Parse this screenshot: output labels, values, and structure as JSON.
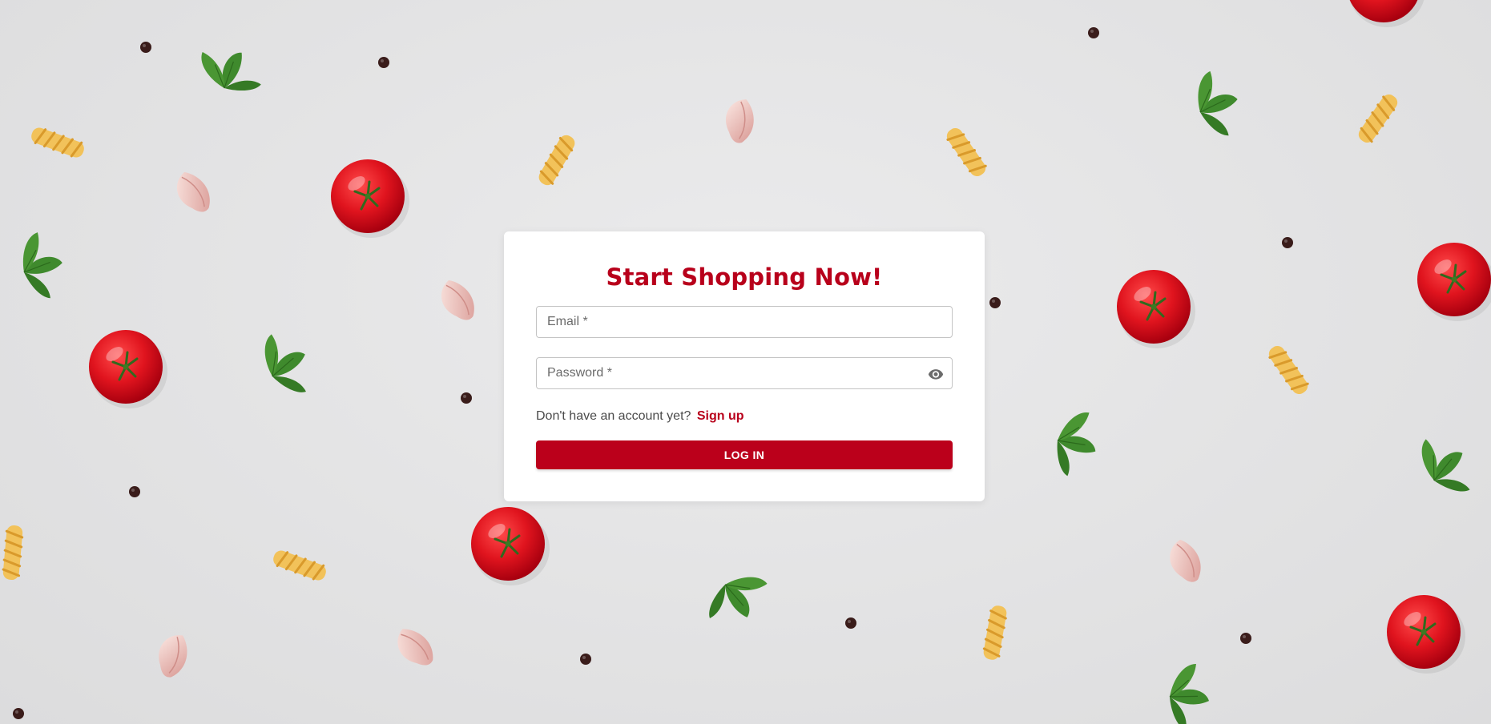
{
  "colors": {
    "accent": "#b8001b",
    "background": "#e5e5e6",
    "card": "#ffffff"
  },
  "background_image": {
    "description": "decorative",
    "items": [
      "tomato-icon",
      "basil-leaf-icon",
      "garlic-clove-icon",
      "fusilli-pasta-icon",
      "peppercorn-icon"
    ]
  },
  "login": {
    "title": "Start Shopping Now!",
    "email": {
      "placeholder": "Email *",
      "value": ""
    },
    "password": {
      "placeholder": "Password *",
      "value": "",
      "toggle_icon": "eye-icon"
    },
    "signup_prompt": "Don't have an account yet?",
    "signup_link": "Sign up",
    "submit_label": "LOG IN"
  }
}
